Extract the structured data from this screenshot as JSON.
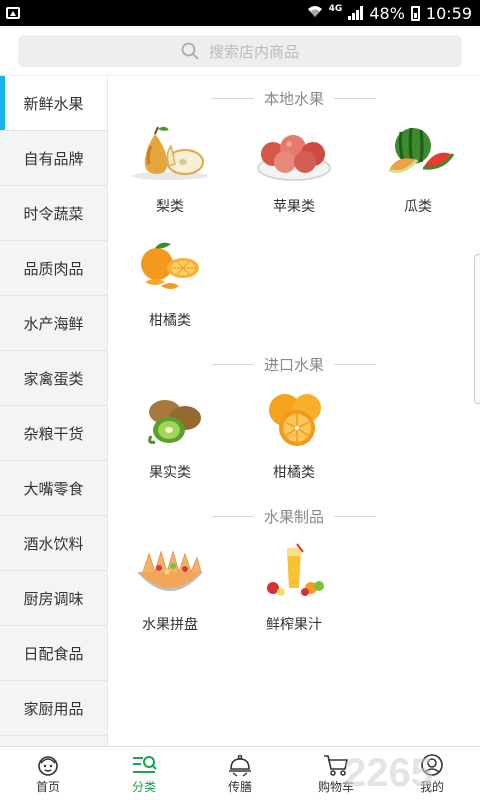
{
  "status_bar": {
    "network": "4G",
    "battery": "48%",
    "time": "10:59"
  },
  "search": {
    "placeholder": "搜索店内商品"
  },
  "sidebar": {
    "items": [
      {
        "label": "新鲜水果"
      },
      {
        "label": "自有品牌"
      },
      {
        "label": "时令蔬菜"
      },
      {
        "label": "品质肉品"
      },
      {
        "label": "水产海鲜"
      },
      {
        "label": "家禽蛋类"
      },
      {
        "label": "杂粮干货"
      },
      {
        "label": "大嘴零食"
      },
      {
        "label": "酒水饮料"
      },
      {
        "label": "厨房调味"
      },
      {
        "label": "日配食品"
      },
      {
        "label": "家厨用品"
      }
    ],
    "active": "新鲜水果"
  },
  "sections": [
    {
      "title": "本地水果",
      "products": [
        {
          "label": "梨类",
          "icon": "pear-icon"
        },
        {
          "label": "苹果类",
          "icon": "apple-icon"
        },
        {
          "label": "瓜类",
          "icon": "melon-icon"
        },
        {
          "label": "柑橘类",
          "icon": "citrus-icon"
        }
      ]
    },
    {
      "title": "进口水果",
      "products": [
        {
          "label": "果实类",
          "icon": "kiwi-icon"
        },
        {
          "label": "柑橘类",
          "icon": "orange-icon"
        }
      ]
    },
    {
      "title": "水果制品",
      "products": [
        {
          "label": "水果拼盘",
          "icon": "fruit-platter-icon"
        },
        {
          "label": "鲜榨果汁",
          "icon": "juice-icon"
        }
      ]
    }
  ],
  "bottom_nav": {
    "items": [
      {
        "label": "首页",
        "icon": "home-face-icon"
      },
      {
        "label": "分类",
        "icon": "category-icon"
      },
      {
        "label": "传膳",
        "icon": "cloche-icon"
      },
      {
        "label": "购物车",
        "icon": "cart-icon"
      },
      {
        "label": "我的",
        "icon": "user-icon"
      }
    ],
    "active": "分类"
  },
  "watermark": "2265",
  "colors": {
    "sidebar_active_bar": "#18b4e8",
    "nav_active": "#1aa34a"
  }
}
